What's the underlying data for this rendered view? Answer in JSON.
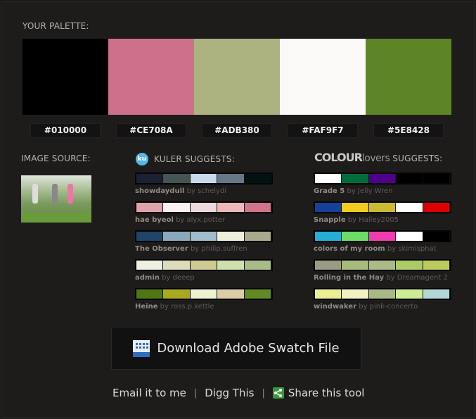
{
  "palette": {
    "label": "YOUR PALETTE:",
    "colors": [
      "#010000",
      "#CE708A",
      "#ADB380",
      "#FAF9F7",
      "#5E8428"
    ]
  },
  "image_source": {
    "label": "IMAGE SOURCE:"
  },
  "kuler": {
    "label": "KULER SUGGESTS:",
    "icon": "ku",
    "items": [
      {
        "name": "showdaydull",
        "by": "by schelydi",
        "colors": [
          "#1d1f33",
          "#445553",
          "#c8dbee",
          "#667788",
          "#011212"
        ]
      },
      {
        "name": "hae byeol",
        "by": "by alyx.potter",
        "colors": [
          "#dea3a8",
          "#fff0f0",
          "#edd9da",
          "#efb8b8",
          "#cf748a"
        ]
      },
      {
        "name": "The Observer",
        "by": "by philip.suffren",
        "colors": [
          "#1f4468",
          "#8aa8bb",
          "#a0bccb",
          "#eeeedf",
          "#aaa98e"
        ]
      },
      {
        "name": "admin",
        "by": "by deeep",
        "colors": [
          "#eef0e1",
          "#dcdbba",
          "#cecb93",
          "#cfdfad",
          "#a8bc89"
        ]
      },
      {
        "name": "Heine",
        "by": "by ross.p.kettle",
        "colors": [
          "#4e7613",
          "#a9a91f",
          "#eef2d3",
          "#ddcca8",
          "#628a25"
        ]
      }
    ]
  },
  "colourlovers": {
    "logo_bold": "COLOUR",
    "logo_light": "lovers",
    "label": "SUGGESTS:",
    "items": [
      {
        "name": "Grade 5",
        "by": "by Jelly Wren",
        "colors": [
          "#ffffff",
          "#006e3c",
          "#4f008a",
          "#000000",
          "#000000"
        ]
      },
      {
        "name": "Snapple",
        "by": "by Hailey2005",
        "colors": [
          "#15419a",
          "#f2cb1d",
          "#cbba32",
          "#ffffff",
          "#dd0000"
        ]
      },
      {
        "name": "colors of my room",
        "by": "by skimisphat",
        "colors": [
          "#28acd8",
          "#6cdc66",
          "#f03cb0",
          "#ffffff",
          "#000000"
        ]
      },
      {
        "name": "Rolling in the Hay",
        "by": "by Dreamagent 2",
        "colors": [
          "#9a9a85",
          "#a8bb7a",
          "#aabb88",
          "#accb66",
          "#bccb5a"
        ]
      },
      {
        "name": "windwaker",
        "by": "by pink-concerto",
        "colors": [
          "#eaef94",
          "#f1f1c2",
          "#a8b887",
          "#ccec96",
          "#b4d6d6"
        ]
      }
    ]
  },
  "download": {
    "label": "Download Adobe Swatch File",
    "icon": "swatch-file-icon"
  },
  "links": {
    "email": "Email it to me",
    "sep": "|",
    "digg": "Digg This",
    "share": "Share this tool"
  }
}
